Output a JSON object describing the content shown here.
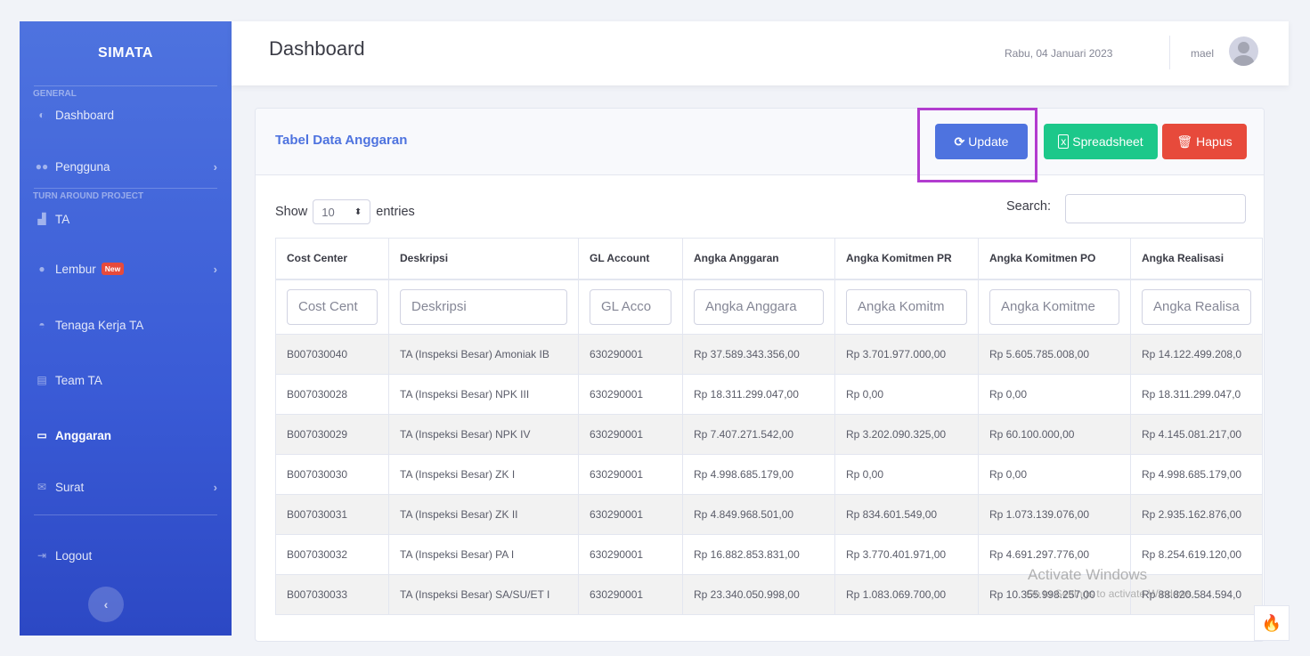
{
  "sidebar": {
    "brand": "SIMATA",
    "headings": {
      "general": "GENERAL",
      "tap": "TURN AROUND PROJECT"
    },
    "items": {
      "dashboard": "Dashboard",
      "pengguna": "Pengguna",
      "ta": "TA",
      "lembur": "Lembur",
      "lembur_badge": "New",
      "tenaga": "Tenaga Kerja TA",
      "team": "Team TA",
      "anggaran": "Anggaran",
      "surat": "Surat",
      "logout": "Logout"
    },
    "active_item": "Anggaran"
  },
  "topbar": {
    "title": "Dashboard",
    "date": "Rabu, 04 Januari 2023",
    "user": "mael"
  },
  "card": {
    "title": "Tabel Data Anggaran",
    "buttons": {
      "update": "Update",
      "spreadsheet": "Spreadsheet",
      "hapus": "Hapus"
    },
    "show_label": "Show",
    "entries_value": "10",
    "entries_label": "entries",
    "search_label": "Search:",
    "columns": [
      "Cost Center",
      "Deskripsi",
      "GL Account",
      "Angka Anggaran",
      "Angka Komitmen PR",
      "Angka Komitmen PO",
      "Angka Realisasi"
    ],
    "filter_placeholders": [
      "Cost Cent",
      "Deskripsi",
      "GL Acco",
      "Angka Anggara",
      "Angka Komitm",
      "Angka Komitme",
      "Angka Realisa"
    ],
    "rows": [
      [
        "B007030040",
        "TA (Inspeksi Besar) Amoniak IB",
        "630290001",
        "Rp 37.589.343.356,00",
        "Rp 3.701.977.000,00",
        "Rp 5.605.785.008,00",
        "Rp 14.122.499.208,0"
      ],
      [
        "B007030028",
        "TA (Inspeksi Besar) NPK III",
        "630290001",
        "Rp 18.311.299.047,00",
        "Rp 0,00",
        "Rp 0,00",
        "Rp 18.311.299.047,0"
      ],
      [
        "B007030029",
        "TA (Inspeksi Besar) NPK IV",
        "630290001",
        "Rp 7.407.271.542,00",
        "Rp 3.202.090.325,00",
        "Rp 60.100.000,00",
        "Rp 4.145.081.217,00"
      ],
      [
        "B007030030",
        "TA (Inspeksi Besar) ZK I",
        "630290001",
        "Rp 4.998.685.179,00",
        "Rp 0,00",
        "Rp 0,00",
        "Rp 4.998.685.179,00"
      ],
      [
        "B007030031",
        "TA (Inspeksi Besar) ZK II",
        "630290001",
        "Rp 4.849.968.501,00",
        "Rp 834.601.549,00",
        "Rp 1.073.139.076,00",
        "Rp 2.935.162.876,00"
      ],
      [
        "B007030032",
        "TA (Inspeksi Besar) PA I",
        "630290001",
        "Rp 16.882.853.831,00",
        "Rp 3.770.401.971,00",
        "Rp 4.691.297.776,00",
        "Rp 8.254.619.120,00"
      ],
      [
        "B007030033",
        "TA (Inspeksi Besar) SA/SU/ET I",
        "630290001",
        "Rp 23.340.050.998,00",
        "Rp 1.083.069.700,00",
        "Rp 10.355.998.257,00",
        "Rp 88.820.584.594,0"
      ]
    ]
  },
  "watermark": {
    "line1": "Activate Windows",
    "line2": "Go to Settings to activate Windows."
  },
  "colors": {
    "primary": "#4e73df",
    "success": "#1cc88a",
    "danger": "#e74a3b",
    "highlight": "#b23ccf"
  }
}
